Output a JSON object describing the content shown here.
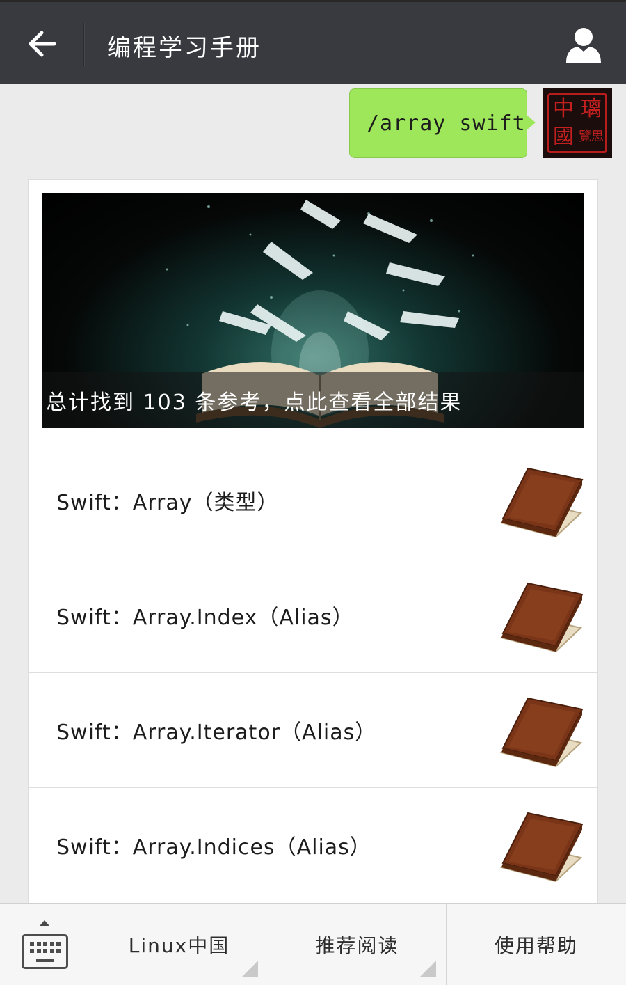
{
  "header": {
    "title": "编程学习手册",
    "back_icon": "arrow-left-icon",
    "profile_icon": "person-icon",
    "background": "#393a3f"
  },
  "message": {
    "text": "/array swift",
    "bubble_color": "#9fe75a",
    "avatar_seal_chars": [
      "中",
      "璃",
      "國",
      "覽思"
    ]
  },
  "card": {
    "banner_caption": "总计找到 103 条参考，点此查看全部结果",
    "results": [
      {
        "title": "Swift：Array（类型）",
        "icon": "book-icon"
      },
      {
        "title": "Swift：Array.Index（Alias）",
        "icon": "book-icon"
      },
      {
        "title": "Swift：Array.Iterator（Alias）",
        "icon": "book-icon"
      },
      {
        "title": "Swift：Array.Indices（Alias）",
        "icon": "book-icon"
      }
    ]
  },
  "menubar": {
    "keyboard_icon": "keyboard-icon",
    "items": [
      {
        "label": "Linux中国",
        "has_submenu": true
      },
      {
        "label": "推荐阅读",
        "has_submenu": true
      },
      {
        "label": "使用帮助",
        "has_submenu": false
      }
    ]
  }
}
